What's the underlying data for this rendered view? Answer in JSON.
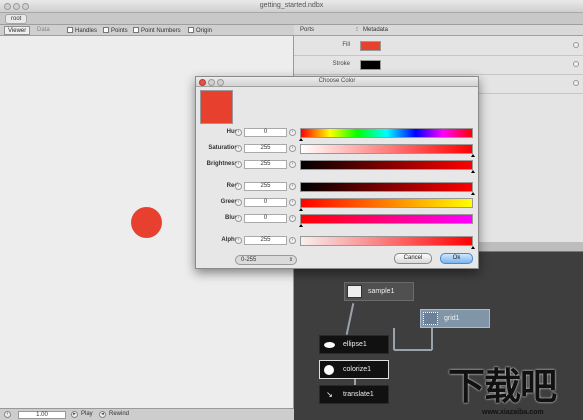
{
  "window": {
    "title": "getting_started.ndbx"
  },
  "breadcrumb": {
    "root": "root"
  },
  "toolbar": {
    "tabs": [
      {
        "label": "Viewer"
      },
      {
        "label": "Data"
      }
    ],
    "checkboxes": [
      {
        "label": "Handles"
      },
      {
        "label": "Points"
      },
      {
        "label": "Point Numbers"
      },
      {
        "label": "Origin"
      }
    ]
  },
  "ports_panel": {
    "tabs": [
      {
        "label": "Ports"
      },
      {
        "label": "Metadata"
      }
    ],
    "rows": [
      {
        "label": "Fill",
        "color": "#e8402f"
      },
      {
        "label": "Stroke",
        "color": "#000000"
      }
    ]
  },
  "viewer": {
    "shape_color": "#e8402f"
  },
  "playback": {
    "frame": "1.00",
    "play_label": "Play",
    "rewind_label": "Rewind"
  },
  "network": {
    "nodes": [
      {
        "label": "sample1"
      },
      {
        "label": "grid1"
      },
      {
        "label": "ellipse1"
      },
      {
        "label": "colorize1"
      },
      {
        "label": "translate1"
      }
    ]
  },
  "color_dialog": {
    "title": "Choose Color",
    "preview_color": "#e8402f",
    "channels": [
      {
        "label": "Hue",
        "value": "0"
      },
      {
        "label": "Saturation",
        "value": "255"
      },
      {
        "label": "Brightness",
        "value": "255"
      },
      {
        "label": "Red",
        "value": "255"
      },
      {
        "label": "Green",
        "value": "0"
      },
      {
        "label": "Blue",
        "value": "0"
      },
      {
        "label": "Alpha",
        "value": "255"
      }
    ],
    "range": "0-255",
    "cancel_label": "Cancel",
    "ok_label": "Ok"
  },
  "watermark": {
    "big": "下载吧",
    "small": "www.xiazaiba.com"
  }
}
